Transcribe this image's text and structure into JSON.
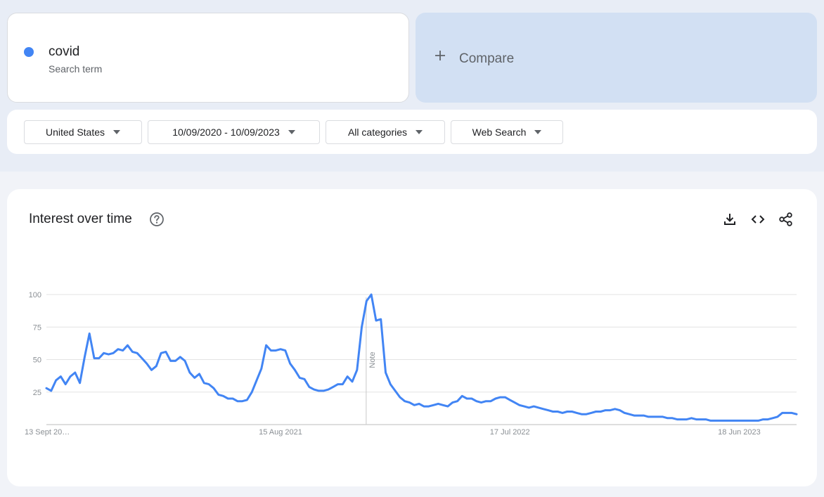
{
  "search_term": {
    "name": "covid",
    "type_label": "Search term",
    "color": "#4285f4"
  },
  "compare": {
    "label": "Compare",
    "icon": "plus-icon"
  },
  "filters": {
    "region": "United States",
    "date_range": "10/09/2020 - 10/09/2023",
    "category": "All categories",
    "search_type": "Web Search"
  },
  "chart_card": {
    "title": "Interest over time",
    "help_icon": "help-circle-icon",
    "tools": [
      "download-icon",
      "embed-code-icon",
      "share-icon"
    ]
  },
  "chart_data": {
    "type": "line",
    "title": "",
    "xlabel": "",
    "ylabel": "",
    "ylim": [
      0,
      100
    ],
    "yticks": [
      25,
      50,
      75,
      100
    ],
    "grid": true,
    "xtick_labels": [
      "13 Sept 20…",
      "15 Aug 2021",
      "17 Jul 2022",
      "18 Jun 2023"
    ],
    "annotation": "Note",
    "series": [
      {
        "color": "#4285f4",
        "values": [
          28,
          26,
          34,
          37,
          31,
          37,
          40,
          32,
          52,
          70,
          51,
          51,
          55,
          54,
          55,
          58,
          57,
          61,
          56,
          55,
          51,
          47,
          42,
          45,
          55,
          56,
          49,
          49,
          52,
          49,
          40,
          36,
          39,
          32,
          31,
          28,
          23,
          22,
          20,
          20,
          18,
          18,
          19,
          25,
          34,
          43,
          61,
          57,
          57,
          58,
          57,
          47,
          42,
          36,
          35,
          29,
          27,
          26,
          26,
          27,
          29,
          31,
          31,
          37,
          33,
          42,
          75,
          95,
          100,
          80,
          81,
          40,
          31,
          26,
          21,
          18,
          17,
          15,
          16,
          14,
          14,
          15,
          16,
          15,
          14,
          17,
          18,
          22,
          20,
          20,
          18,
          17,
          18,
          18,
          20,
          21,
          21,
          19,
          17,
          15,
          14,
          13,
          14,
          13,
          12,
          11,
          10,
          10,
          9,
          10,
          10,
          9,
          8,
          8,
          9,
          10,
          10,
          11,
          11,
          12,
          11,
          9,
          8,
          7,
          7,
          7,
          6,
          6,
          6,
          6,
          5,
          5,
          4,
          4,
          4,
          5,
          4,
          4,
          4,
          3,
          3,
          3,
          3,
          3,
          3,
          3,
          3,
          3,
          3,
          3,
          4,
          4,
          5,
          6,
          9,
          9,
          9,
          8
        ]
      }
    ]
  }
}
